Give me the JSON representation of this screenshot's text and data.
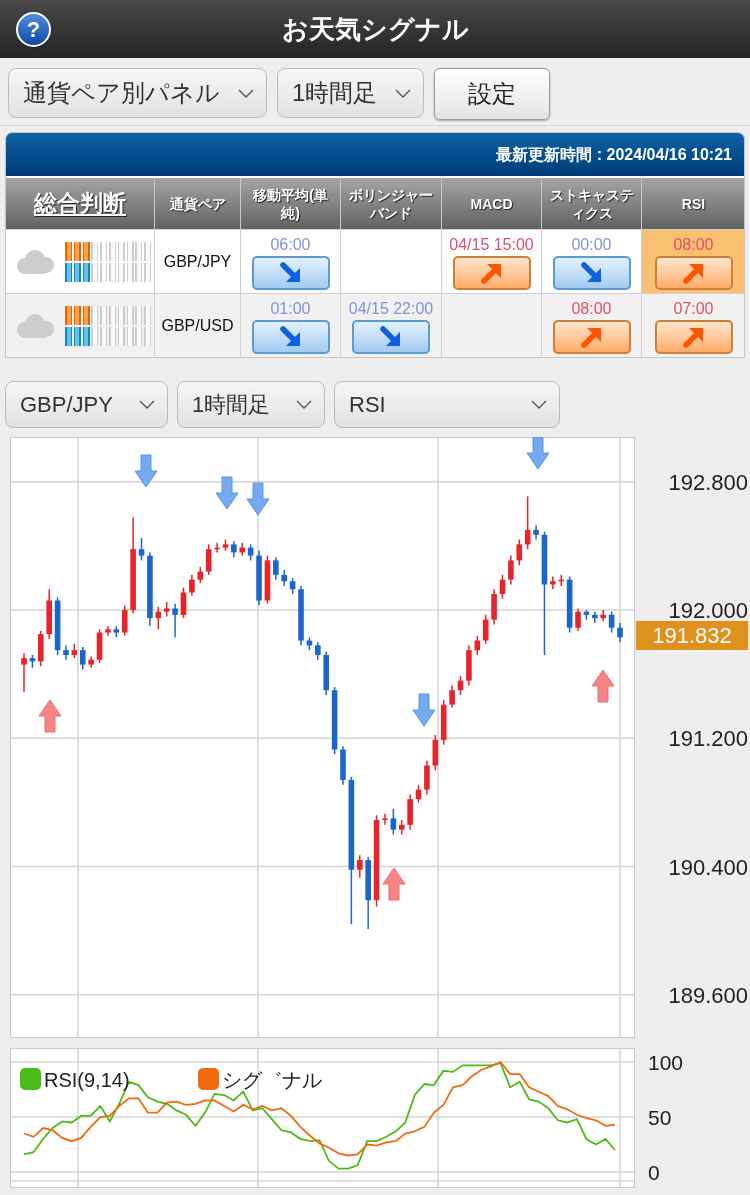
{
  "header": {
    "help_button": "?",
    "title": "お天気シグナル"
  },
  "toolbar": {
    "view_select": "通貨ペア別パネル",
    "timeframe_select": "1時間足",
    "settings_button": "設定"
  },
  "signal_panel": {
    "updated": "最新更新時間 : 2024/04/16 10:21",
    "columns": [
      "総合判断",
      "通貨ペア",
      "移動平均(単純)",
      "ボリンジャーバンド",
      "MACD",
      "ストキャスティクス",
      "RSI"
    ],
    "rows": [
      {
        "meters": [
          {
            "kind": "buy",
            "level": 0.3
          },
          {
            "kind": "sell",
            "level": 0.3
          }
        ],
        "pair": "GBP/JPY",
        "signals": {
          "moving_average": {
            "time": "06:00",
            "kind": "down",
            "highlighted": false
          },
          "macd": {
            "time": "04/15 15:00",
            "kind": "up",
            "highlighted": false
          },
          "stochastics": {
            "time": "00:00",
            "kind": "down",
            "highlighted": false
          },
          "rsi": {
            "time": "08:00",
            "kind": "up",
            "highlighted": true
          }
        }
      },
      {
        "meters": [
          {
            "kind": "buy",
            "level": 0.3
          },
          {
            "kind": "sell",
            "level": 0.3
          }
        ],
        "pair": "GBP/USD",
        "signals": {
          "moving_average": {
            "time": "01:00",
            "kind": "down",
            "highlighted": false
          },
          "bollinger_band": {
            "time": "04/15 22:00",
            "kind": "down",
            "highlighted": false
          },
          "stochastics": {
            "time": "08:00",
            "kind": "up",
            "highlighted": false
          },
          "rsi": {
            "time": "07:00",
            "kind": "up",
            "highlighted": false
          }
        }
      }
    ]
  },
  "chart_controls": {
    "pair_select": "GBP/JPY",
    "timeframe_select": "1時間足",
    "indicator_select": "RSI"
  },
  "price_chart": {
    "chart_data": {
      "type": "candlestick",
      "grid": true,
      "ylim": [
        189.33,
        193.08
      ],
      "yticks": [
        {
          "value": 192.8,
          "label": "192.800"
        },
        {
          "value": 192.0,
          "label": "192.000"
        },
        {
          "value": 191.2,
          "label": "191.200"
        },
        {
          "value": 190.4,
          "label": "190.400"
        },
        {
          "value": 189.6,
          "label": "189.600"
        }
      ],
      "ohlc": [
        [
          191.66,
          191.73,
          191.49,
          191.7
        ],
        [
          191.7,
          191.72,
          191.64,
          191.68
        ],
        [
          191.68,
          191.87,
          191.65,
          191.85
        ],
        [
          191.85,
          192.13,
          191.82,
          192.06
        ],
        [
          192.06,
          192.08,
          191.72,
          191.75
        ],
        [
          191.75,
          191.78,
          191.69,
          191.72
        ],
        [
          191.72,
          191.79,
          191.7,
          191.75
        ],
        [
          191.75,
          191.77,
          191.63,
          191.66
        ],
        [
          191.66,
          191.71,
          191.64,
          191.69
        ],
        [
          191.69,
          191.88,
          191.67,
          191.86
        ],
        [
          191.86,
          191.9,
          191.84,
          191.88
        ],
        [
          191.88,
          191.9,
          191.83,
          191.86
        ],
        [
          191.86,
          192.03,
          191.84,
          192.0
        ],
        [
          192.0,
          192.58,
          191.98,
          192.38
        ],
        [
          192.38,
          192.45,
          192.31,
          192.34
        ],
        [
          192.34,
          192.36,
          191.9,
          191.95
        ],
        [
          191.95,
          192.02,
          191.88,
          191.99
        ],
        [
          191.99,
          192.05,
          191.96,
          192.01
        ],
        [
          192.01,
          192.04,
          191.83,
          191.97
        ],
        [
          191.97,
          192.14,
          191.95,
          192.11
        ],
        [
          192.11,
          192.22,
          192.09,
          192.19
        ],
        [
          192.19,
          192.27,
          192.17,
          192.24
        ],
        [
          192.24,
          192.41,
          192.22,
          192.38
        ],
        [
          192.38,
          192.42,
          192.36,
          192.39
        ],
        [
          192.39,
          192.44,
          192.37,
          192.41
        ],
        [
          192.41,
          192.43,
          192.33,
          192.36
        ],
        [
          192.36,
          192.42,
          192.34,
          192.39
        ],
        [
          192.39,
          192.41,
          192.31,
          192.34
        ],
        [
          192.34,
          192.37,
          192.03,
          192.06
        ],
        [
          192.06,
          192.34,
          192.04,
          192.31
        ],
        [
          192.31,
          192.33,
          192.19,
          192.22
        ],
        [
          192.22,
          192.25,
          192.15,
          192.18
        ],
        [
          192.18,
          192.2,
          192.1,
          192.13
        ],
        [
          192.13,
          192.15,
          191.78,
          191.81
        ],
        [
          191.81,
          191.83,
          191.75,
          191.78
        ],
        [
          191.78,
          191.8,
          191.69,
          191.72
        ],
        [
          191.72,
          191.74,
          191.47,
          191.5
        ],
        [
          191.5,
          191.52,
          191.1,
          191.13
        ],
        [
          191.13,
          191.15,
          190.91,
          190.94
        ],
        [
          190.94,
          190.96,
          190.04,
          190.38
        ],
        [
          190.38,
          190.47,
          190.33,
          190.44
        ],
        [
          190.44,
          190.46,
          190.01,
          190.19
        ],
        [
          190.19,
          190.72,
          190.15,
          190.69
        ],
        [
          190.69,
          190.73,
          190.66,
          190.7
        ],
        [
          190.7,
          190.76,
          190.6,
          190.63
        ],
        [
          190.63,
          190.69,
          190.6,
          190.66
        ],
        [
          190.66,
          190.85,
          190.63,
          190.82
        ],
        [
          190.82,
          190.91,
          190.8,
          190.88
        ],
        [
          190.88,
          191.06,
          190.85,
          191.03
        ],
        [
          191.03,
          191.22,
          191.0,
          191.19
        ],
        [
          191.19,
          191.44,
          191.16,
          191.41
        ],
        [
          191.41,
          191.53,
          191.39,
          191.5
        ],
        [
          191.5,
          191.59,
          191.47,
          191.56
        ],
        [
          191.56,
          191.78,
          191.53,
          191.75
        ],
        [
          191.75,
          191.84,
          191.72,
          191.81
        ],
        [
          191.81,
          191.97,
          191.79,
          191.94
        ],
        [
          191.94,
          192.13,
          191.91,
          192.1
        ],
        [
          192.1,
          192.22,
          192.07,
          192.19
        ],
        [
          192.19,
          192.34,
          192.16,
          192.31
        ],
        [
          192.31,
          192.44,
          192.28,
          192.41
        ],
        [
          192.41,
          192.71,
          192.38,
          192.5
        ],
        [
          192.5,
          192.53,
          192.44,
          192.47
        ],
        [
          192.47,
          192.49,
          191.72,
          192.16
        ],
        [
          192.16,
          192.21,
          192.13,
          192.18
        ],
        [
          192.18,
          192.22,
          192.15,
          192.19
        ],
        [
          192.19,
          192.21,
          191.86,
          191.89
        ],
        [
          191.89,
          192.01,
          191.87,
          191.99
        ],
        [
          191.99,
          192.0,
          191.94,
          191.97
        ],
        [
          191.97,
          191.99,
          191.92,
          191.95
        ],
        [
          191.95,
          192.0,
          191.93,
          191.97
        ],
        [
          191.97,
          191.99,
          191.86,
          191.89
        ],
        [
          191.89,
          191.92,
          191.8,
          191.83
        ]
      ]
    },
    "current_price": "191.832"
  },
  "indicator_chart": {
    "chart_data": {
      "type": "line",
      "grid": true,
      "ylim": [
        0,
        100
      ],
      "yticks": [
        0,
        50,
        100
      ],
      "legend": "upper left",
      "series": [
        {
          "name": "RSI(9,14)",
          "color": "#4cbb17",
          "values": [
            16,
            18,
            30,
            40,
            46,
            45,
            51,
            51,
            60,
            46,
            62,
            82,
            79,
            68,
            64,
            62,
            56,
            52,
            42,
            54,
            71,
            70,
            65,
            73,
            56,
            58,
            48,
            38,
            36,
            30,
            28,
            29,
            10,
            3,
            3,
            6,
            28,
            28,
            32,
            37,
            45,
            70,
            80,
            79,
            92,
            91,
            97,
            97,
            97,
            97,
            99,
            77,
            82,
            66,
            64,
            58,
            47,
            45,
            48,
            30,
            25,
            30,
            20
          ]
        },
        {
          "name": "シグ゛ナル",
          "color": "#f06a10",
          "values": [
            35,
            32,
            40,
            38,
            31,
            28,
            31,
            41,
            50,
            51,
            60,
            67,
            67,
            54,
            54,
            63,
            64,
            61,
            62,
            65,
            65,
            60,
            55,
            61,
            57,
            60,
            56,
            58,
            51,
            41,
            33,
            26,
            22,
            17,
            15,
            16,
            25,
            24,
            27,
            28,
            35,
            37,
            41,
            54,
            61,
            77,
            79,
            87,
            93,
            96,
            100,
            89,
            89,
            77,
            73,
            69,
            60,
            57,
            52,
            49,
            47,
            42,
            43
          ]
        }
      ]
    }
  }
}
